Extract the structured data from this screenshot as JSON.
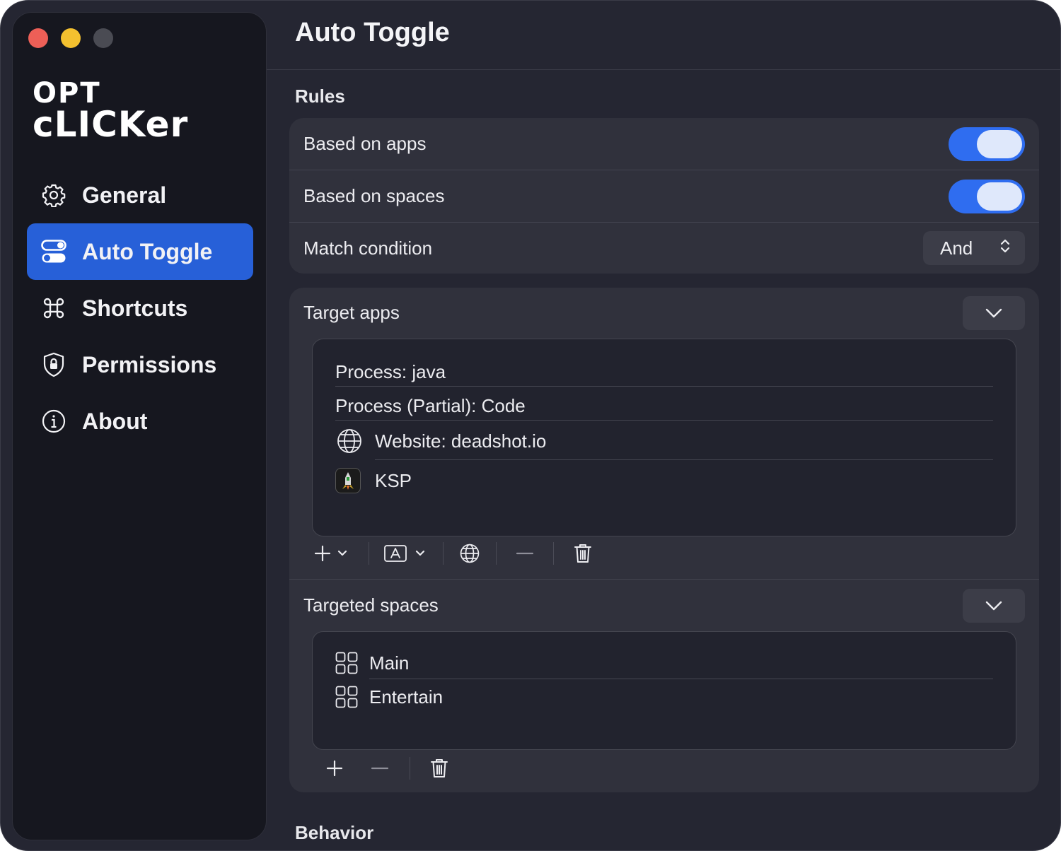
{
  "window": {
    "traffic_lights": [
      "close",
      "minimize",
      "zoom"
    ]
  },
  "sidebar": {
    "logo_line1": "OPT",
    "logo_line2": "cLICKer",
    "items": [
      {
        "label": "General",
        "icon": "gear-icon"
      },
      {
        "label": "Auto Toggle",
        "icon": "toggles-icon",
        "active": true
      },
      {
        "label": "Shortcuts",
        "icon": "command-icon"
      },
      {
        "label": "Permissions",
        "icon": "shield-lock-icon"
      },
      {
        "label": "About",
        "icon": "info-icon"
      }
    ]
  },
  "header": {
    "title": "Auto Toggle"
  },
  "rules": {
    "heading": "Rules",
    "based_on_apps": {
      "label": "Based on apps",
      "on": true
    },
    "based_on_spaces": {
      "label": "Based on spaces",
      "on": true
    },
    "match_condition": {
      "label": "Match condition",
      "value": "And"
    }
  },
  "target_apps": {
    "label": "Target apps",
    "items": [
      {
        "text": "Process: java",
        "icon": ""
      },
      {
        "text": "Process (Partial): Code",
        "icon": ""
      },
      {
        "text": "Website: deadshot.io",
        "icon": "globe-icon"
      },
      {
        "text": "KSP",
        "icon": "ksp-app-icon"
      }
    ]
  },
  "targeted_spaces": {
    "label": "Targeted spaces",
    "items": [
      {
        "text": "Main",
        "icon": "grid-icon"
      },
      {
        "text": "Entertain",
        "icon": "grid-icon"
      }
    ]
  },
  "behavior": {
    "heading": "Behavior"
  },
  "colors": {
    "accent": "#2760d8",
    "toggle_on": "#2f6df0",
    "window_bg": "#252632",
    "sidebar_bg": "#16171f"
  }
}
